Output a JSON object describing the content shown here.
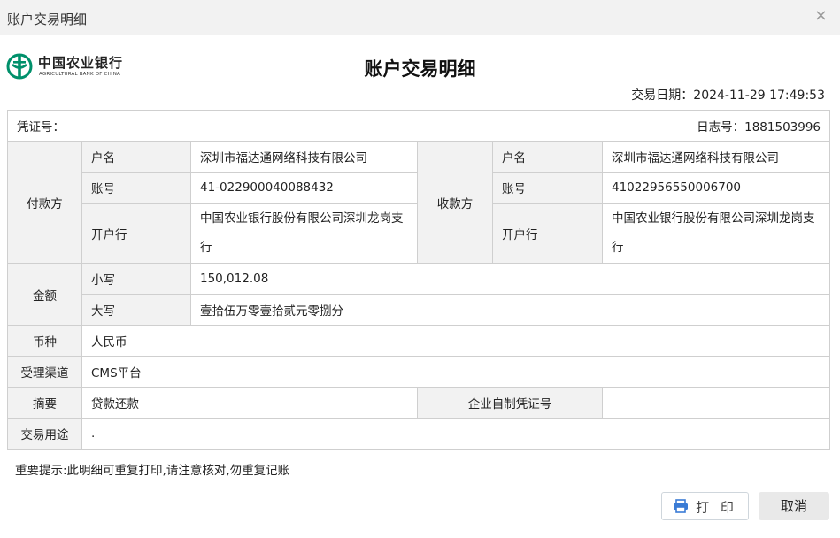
{
  "window": {
    "title": "账户交易明细",
    "close_glyph": "×"
  },
  "bank": {
    "name_cn": "中国农业银行",
    "name_en": "AGRICULTURAL BANK OF CHINA",
    "brand_color": "#00906b"
  },
  "document": {
    "title": "账户交易明细",
    "date_label": "交易日期：",
    "date_value": "2024-11-29 17:49:53"
  },
  "voucher": {
    "label": "凭证号：",
    "log_label": "日志号：",
    "log_value": "1881503996"
  },
  "payer": {
    "section": "付款方",
    "name_label": "户名",
    "name": "深圳市福达通网络科技有限公司",
    "account_label": "账号",
    "account": "41-022900040088432",
    "bank_label": "开户行",
    "bank_line1": "中国农业银行股份有限公司深圳龙岗支",
    "bank_line2": "行"
  },
  "payee": {
    "section": "收款方",
    "name_label": "户名",
    "name": "深圳市福达通网络科技有限公司",
    "account_label": "账号",
    "account": "41022956550006700",
    "bank_label": "开户行",
    "bank_line1": "中国农业银行股份有限公司深圳龙岗支",
    "bank_line2": "行"
  },
  "amount": {
    "section": "金额",
    "small_label": "小写",
    "small": "150,012.08",
    "big_label": "大写",
    "big": "壹拾伍万零壹拾贰元零捌分"
  },
  "currency": {
    "label": "币种",
    "value": "人民币"
  },
  "channel": {
    "label": "受理渠道",
    "value": "CMS平台"
  },
  "summary": {
    "label": "摘要",
    "value": "贷款还款",
    "voucher_label": "企业自制凭证号",
    "voucher_value": ""
  },
  "purpose": {
    "label": "交易用途",
    "value": "."
  },
  "notice": "重要提示:此明细可重复打印,请注意核对,勿重复记账",
  "buttons": {
    "print": "打 印",
    "cancel": "取消",
    "print_icon": "printer-icon"
  }
}
